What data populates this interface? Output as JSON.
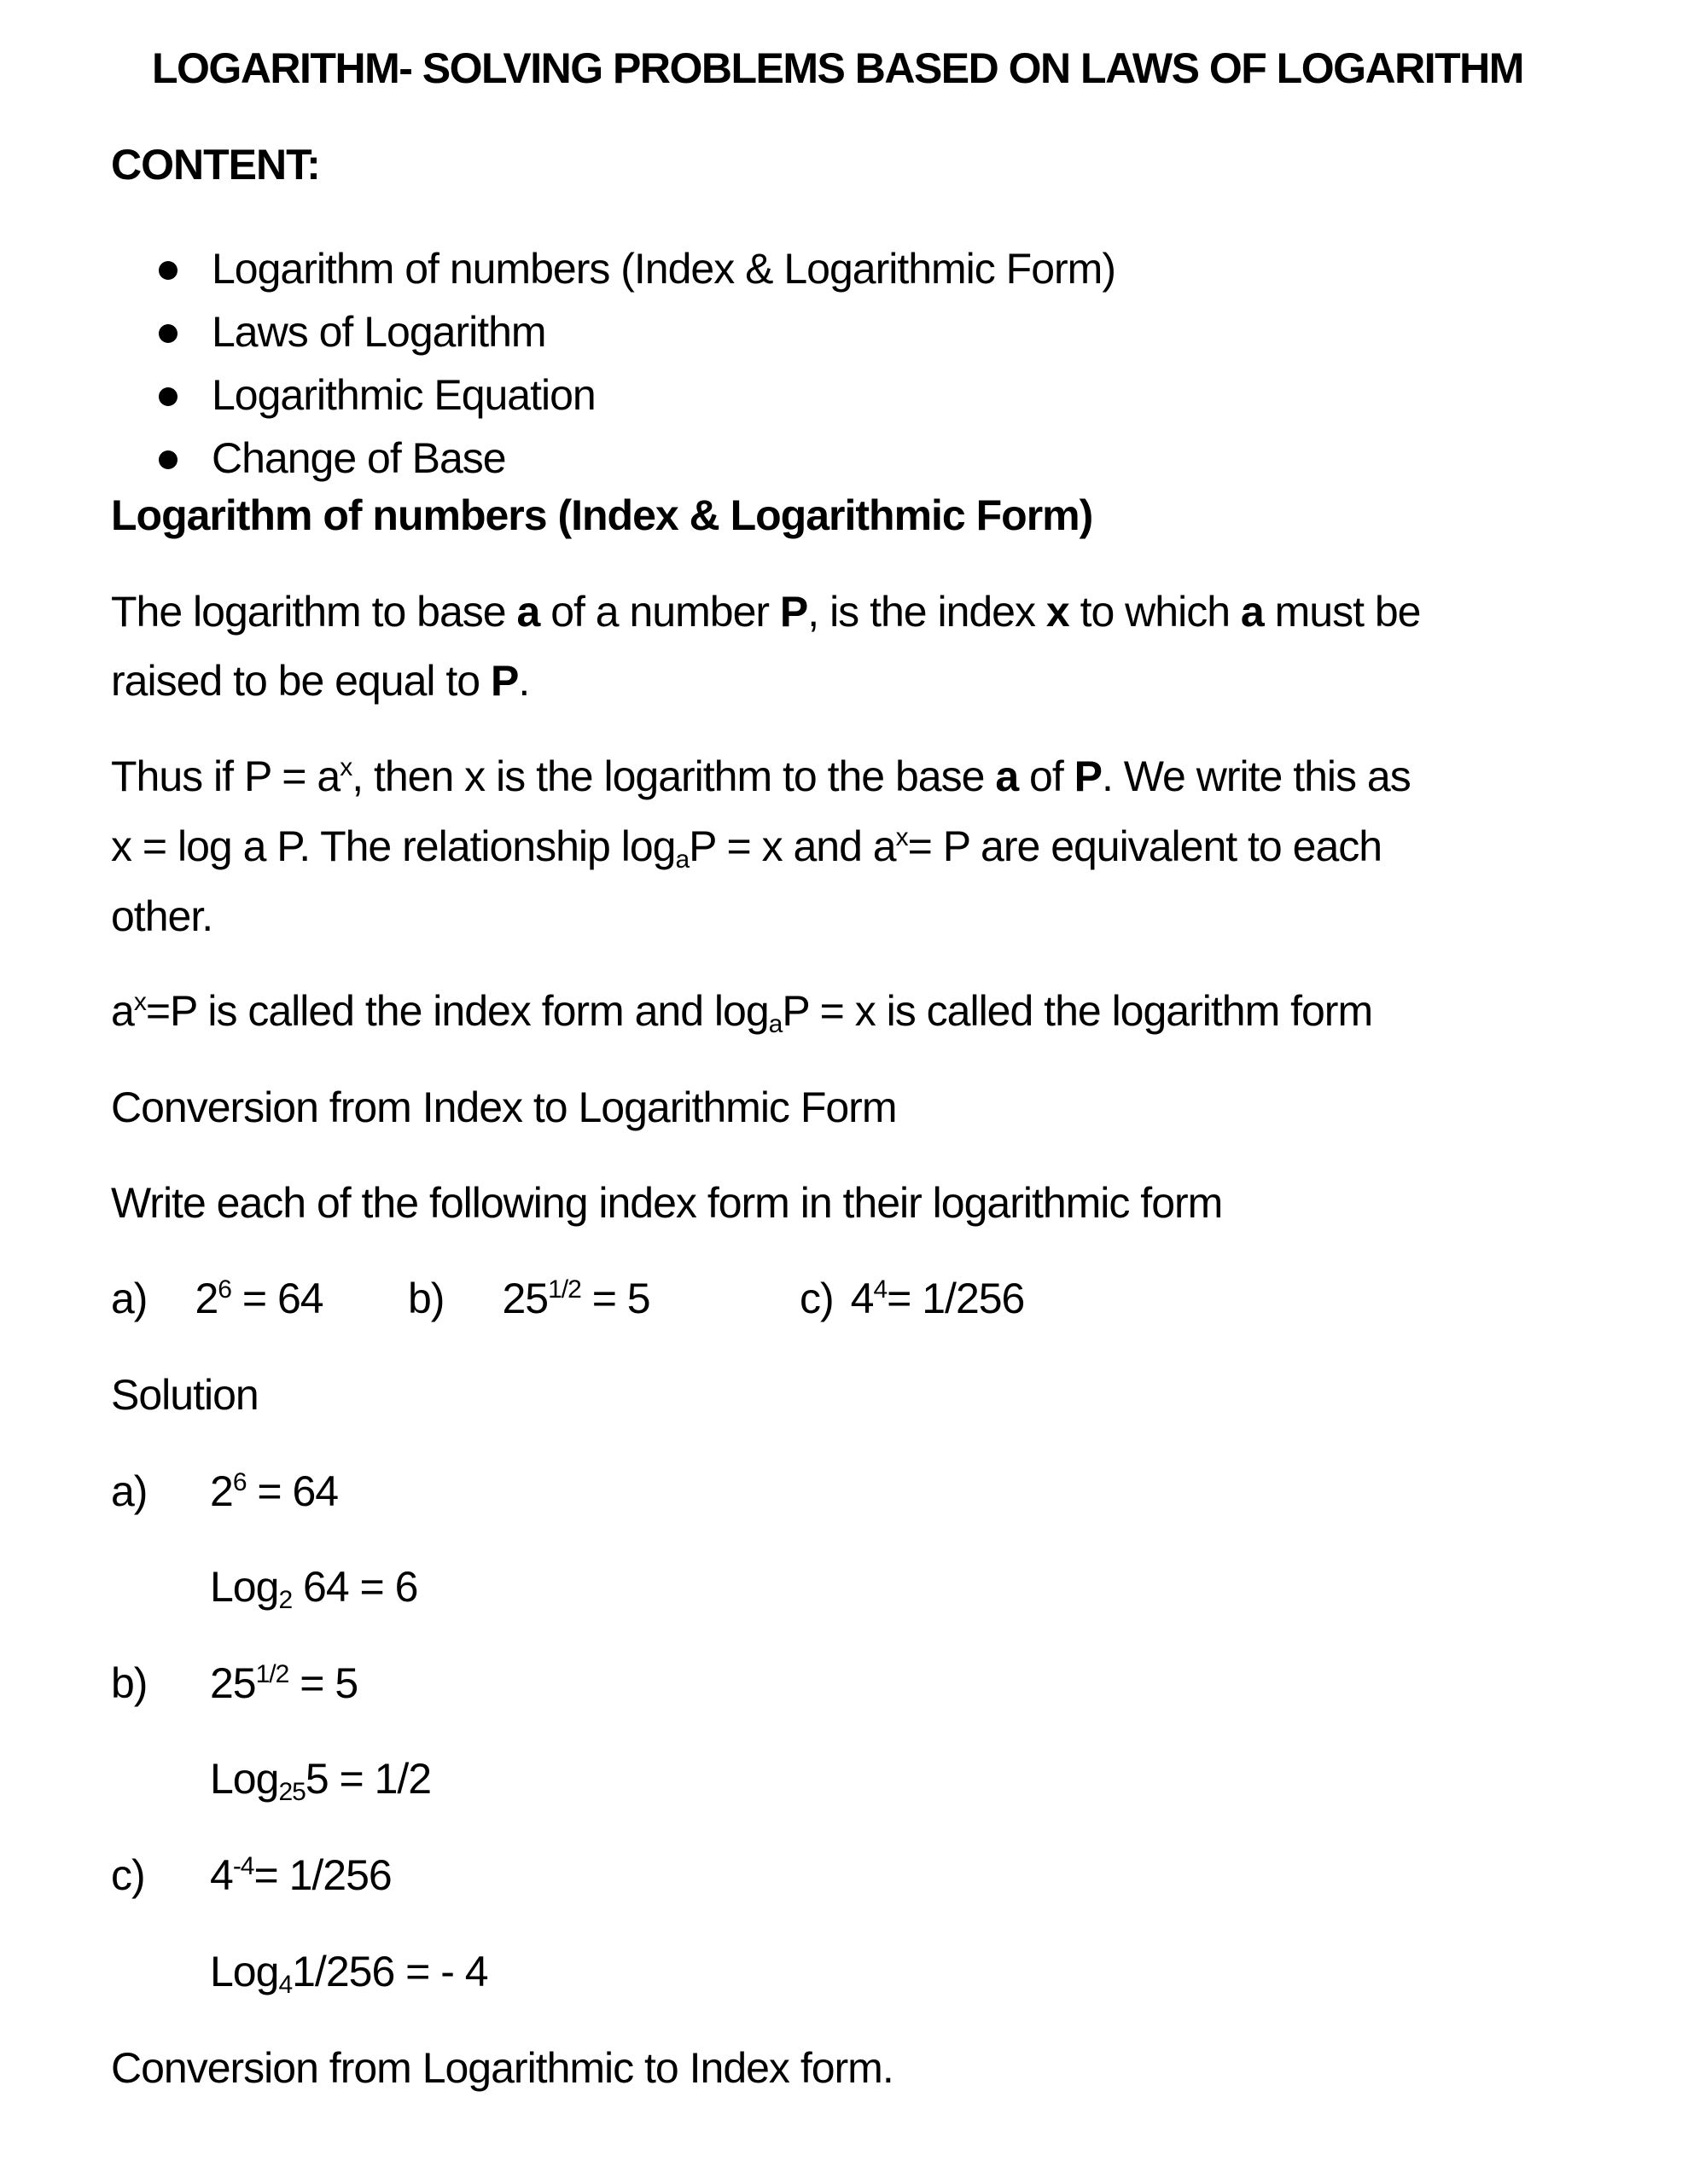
{
  "title": "LOGARITHM- SOLVING PROBLEMS BASED ON LAWS OF LOGARITHM",
  "content_label": "CONTENT:",
  "content_items": [
    "Logarithm of numbers (Index & Logarithmic Form)",
    "Laws of Logarithm",
    "Logarithmic Equation",
    "Change of Base"
  ],
  "section_heading": "Logarithm of numbers (Index & Logarithmic Form)",
  "definition": {
    "t1": "The logarithm to base ",
    "b1": "a",
    "t2": " of a number ",
    "b2": "P",
    "t3": ", is the index ",
    "b3": "x",
    "t4": " to which ",
    "b4": "a",
    "t5": " must be",
    "l2_t1": "raised to be equal to ",
    "l2_b1": "P",
    "l2_t2": "."
  },
  "thus": {
    "l1_t1": "Thus if P = a",
    "l1_sup": "x",
    "l1_t2": ", then x is the logarithm to the base ",
    "l1_b1": "a",
    "l1_t3": " of ",
    "l1_b2": "P",
    "l1_t4": ". We write this as",
    "l2_t1": "x = log a P. The relationship log",
    "l2_sub": "a",
    "l2_t2": "P = x and a",
    "l2_sup": "x",
    "l2_t3": "= P are equivalent to each",
    "l3": "other."
  },
  "forms": {
    "t1": "a",
    "sup": "x",
    "t2": "=P is called the index form and log",
    "sub": "a",
    "t3": "P = x is called the logarithm form"
  },
  "conversion_heading": "Conversion from Index to Logarithmic Form",
  "instruction": "Write each of the following index form in their logarithmic form",
  "exercises": [
    {
      "label": "a)",
      "base": "2",
      "exp": "6",
      "rhs": " = 64"
    },
    {
      "label": "b)",
      "base": "25",
      "exp": "1/2",
      "rhs": " = 5"
    },
    {
      "label": "c)",
      "base": "4",
      "exp": "4",
      "rhs": "= 1/256"
    }
  ],
  "solution_label": "Solution",
  "solutions": [
    {
      "label": "a)",
      "base": "2",
      "exp": "6",
      "rhs": " = 64",
      "log": "Log",
      "log_sub": "2",
      "log_rest": " 64 = 6"
    },
    {
      "label": "b)",
      "base": "25",
      "exp": "1/2",
      "rhs": " = 5",
      "log": "Log",
      "log_sub": "25",
      "log_rest": "5 = 1/2"
    },
    {
      "label": "c)",
      "base": "4",
      "exp": "-4",
      "rhs": "= 1/256",
      "log": "Log",
      "log_sub": "4",
      "log_rest": "1/256 = - 4"
    }
  ],
  "final_heading": "Conversion from Logarithmic to Index form."
}
